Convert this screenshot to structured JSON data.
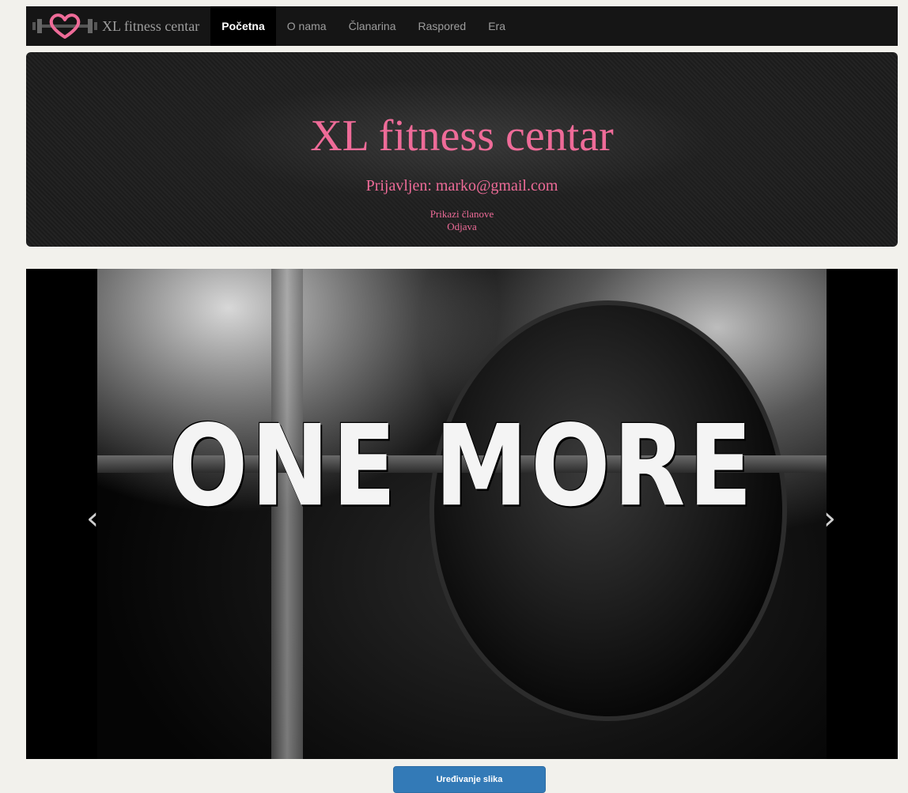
{
  "navbar": {
    "brand_text": "XL fitness centar",
    "logo_icon": "heart-dumbbell-logo",
    "items": [
      {
        "label": "Početna",
        "active": true
      },
      {
        "label": "O nama",
        "active": false
      },
      {
        "label": "Članarina",
        "active": false
      },
      {
        "label": "Raspored",
        "active": false
      },
      {
        "label": "Era",
        "active": false
      }
    ]
  },
  "header": {
    "title": "XL fitness centar",
    "user_line": "Prijavljen: marko@gmail.com",
    "links": [
      "Prikazi članove",
      "Odjava"
    ]
  },
  "carousel": {
    "caption": "ONE MORE",
    "prev_icon": "chevron-left-icon",
    "next_icon": "chevron-right-icon"
  },
  "actions": {
    "edit_images_label": "Uređivanje slika"
  },
  "colors": {
    "accent_pink": "#ee6b98",
    "navbar_bg": "#151515",
    "button_blue": "#337ab7",
    "page_bg": "#f2f1ec"
  }
}
